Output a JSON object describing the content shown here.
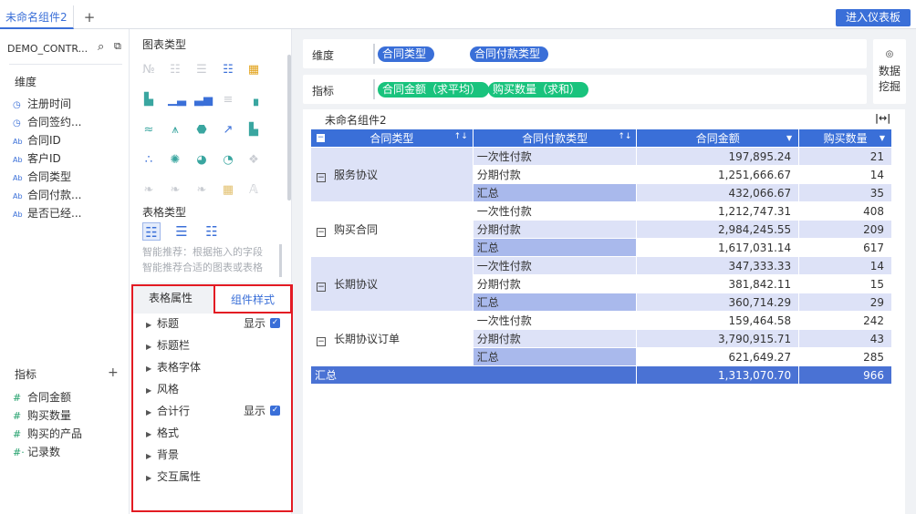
{
  "topbar": {
    "tab_label": "未命名组件2",
    "add_tab": "+",
    "enter_dashboard": "进入仪表板"
  },
  "datasource": {
    "name": "DEMO_CONTR...",
    "search_icon": "search-icon",
    "switch_icon": "switch-icon"
  },
  "dimensions": {
    "title": "维度",
    "fields": [
      {
        "icon": "clock",
        "label": "注册时间"
      },
      {
        "icon": "clock",
        "label": "合同签约..."
      },
      {
        "icon": "Ab",
        "label": "合同ID"
      },
      {
        "icon": "Ab",
        "label": "客户ID"
      },
      {
        "icon": "Ab",
        "label": "合同类型"
      },
      {
        "icon": "Ab",
        "label": "合同付款..."
      },
      {
        "icon": "Ab",
        "label": "是否已经..."
      }
    ]
  },
  "measures": {
    "title": "指标",
    "add": "+",
    "fields": [
      {
        "icon": "#",
        "label": "合同金额"
      },
      {
        "icon": "#",
        "label": "购买数量"
      },
      {
        "icon": "#",
        "label": "购买的产品"
      },
      {
        "icon": "#·",
        "label": "记录数"
      }
    ]
  },
  "chart_panel": {
    "chart_type_title": "图表类型",
    "table_type_title": "表格类型",
    "smart_line1": "智能推荐：根据拖入的字段",
    "smart_line2": "智能推荐合适的图表或表格"
  },
  "prop_tabs": {
    "table_attr": "表格属性",
    "component_style": "组件样式"
  },
  "props": [
    {
      "label": "标题",
      "show": "显示",
      "checked": true
    },
    {
      "label": "标题栏"
    },
    {
      "label": "表格字体"
    },
    {
      "label": "风格"
    },
    {
      "label": "合计行",
      "show": "显示",
      "checked": true
    },
    {
      "label": "格式"
    },
    {
      "label": "背景"
    },
    {
      "label": "交互属性"
    }
  ],
  "shelf": {
    "dim_label": "维度",
    "dim_pills": [
      "合同类型",
      "合同付款类型"
    ],
    "measure_label": "指标",
    "measure_pills": [
      "合同金额（求平均）",
      "购买数量（求和）"
    ]
  },
  "mining": {
    "icon": "mining-icon",
    "label": "数据挖掘"
  },
  "component": {
    "title": "未命名组件2",
    "fit_icon": "fit-width-icon"
  },
  "table": {
    "headers": [
      "合同类型",
      "合同付款类型",
      "合同金额",
      "购买数量"
    ],
    "groups": [
      {
        "name": "服务协议",
        "rows": [
          [
            "一次性付款",
            "197,895.24",
            "21"
          ],
          [
            "分期付款",
            "1,251,666.67",
            "14"
          ],
          [
            "汇总",
            "432,066.67",
            "35"
          ]
        ]
      },
      {
        "name": "购买合同",
        "rows": [
          [
            "一次性付款",
            "1,212,747.31",
            "408"
          ],
          [
            "分期付款",
            "2,984,245.55",
            "209"
          ],
          [
            "汇总",
            "1,617,031.14",
            "617"
          ]
        ]
      },
      {
        "name": "长期协议",
        "rows": [
          [
            "一次性付款",
            "347,333.33",
            "14"
          ],
          [
            "分期付款",
            "381,842.11",
            "15"
          ],
          [
            "汇总",
            "360,714.29",
            "29"
          ]
        ]
      },
      {
        "name": "长期协议订单",
        "rows": [
          [
            "一次性付款",
            "159,464.58",
            "242"
          ],
          [
            "分期付款",
            "3,790,915.71",
            "43"
          ],
          [
            "汇总",
            "621,649.27",
            "285"
          ]
        ]
      }
    ],
    "total": {
      "label": "汇总",
      "amount": "1,313,070.70",
      "qty": "966"
    }
  },
  "colors": {
    "accent": "#3a6fd8",
    "green": "#19c37d",
    "highlight": "#e31b23",
    "row_tint": "#dde2f7",
    "subtotal": "#a9b9ec"
  }
}
